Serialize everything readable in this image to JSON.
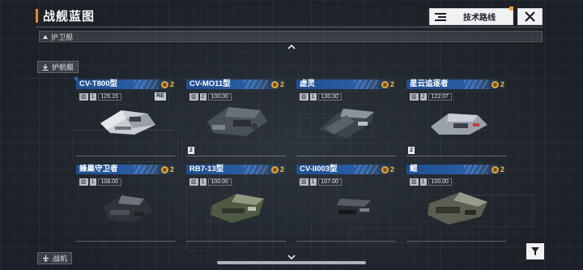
{
  "header": {
    "title": "战舰蓝图",
    "tech_route_label": "技术路线"
  },
  "sections": {
    "escort_ship_label": "护卫舰",
    "escort_boat_label": "护航艇",
    "fighter_label": "战机"
  },
  "cards": [
    {
      "name": "CV-T800型",
      "count": "2",
      "level": "1",
      "value": "126.15",
      "badge": "RE",
      "foot_num": ""
    },
    {
      "name": "CV-MO11型",
      "count": "2",
      "level": "2",
      "value": "100.00",
      "badge": "",
      "foot_num": "2"
    },
    {
      "name": "虚灵",
      "count": "2",
      "level": "1",
      "value": "130.00",
      "badge": "",
      "foot_num": ""
    },
    {
      "name": "星云追逐者",
      "count": "2",
      "level": "2",
      "value": "122.07",
      "badge": "",
      "foot_num": "2"
    },
    {
      "name": "蜂巢守卫者",
      "count": "2",
      "level": "1",
      "value": "108.00",
      "badge": "",
      "foot_num": ""
    },
    {
      "name": "RB7-13型",
      "count": "2",
      "level": "1",
      "value": "100.00",
      "badge": "",
      "foot_num": ""
    },
    {
      "name": "CV-II003型",
      "count": "2",
      "level": "1",
      "value": "107.00",
      "badge": "",
      "foot_num": ""
    },
    {
      "name": "鲲",
      "count": "2",
      "level": "1",
      "value": "100.00",
      "badge": "",
      "foot_num": ""
    }
  ],
  "colors": {
    "accent": "#e0892a",
    "card_header": "#2a5ea4",
    "count_gold": "#f3c04a"
  }
}
